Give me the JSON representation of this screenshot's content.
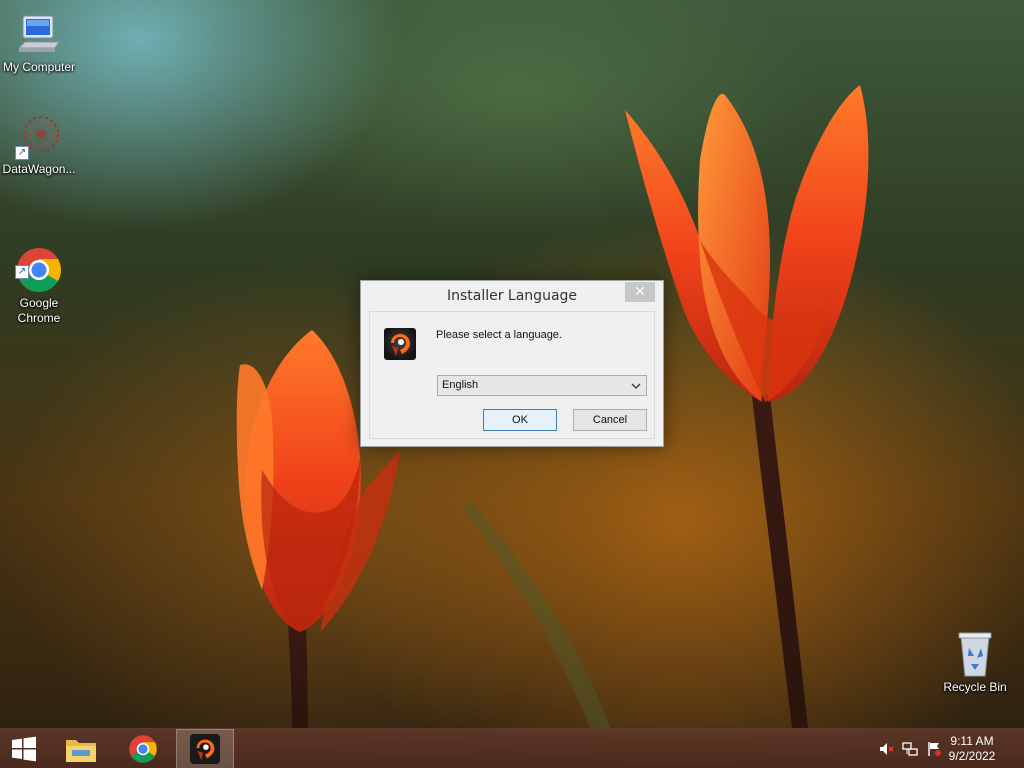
{
  "desktop": {
    "icons": [
      {
        "label": "My Computer",
        "icon": "computer-icon"
      },
      {
        "label": "DataWagon...",
        "icon": "datawagon-icon"
      },
      {
        "label": "Google\nChrome",
        "icon": "chrome-icon"
      },
      {
        "label": "Recycle Bin",
        "icon": "recycle-bin-icon"
      }
    ]
  },
  "dialog": {
    "title": "Installer Language",
    "close_glyph": "✕",
    "prompt": "Please select a language.",
    "language_selected": "English",
    "ok_label": "OK",
    "cancel_label": "Cancel"
  },
  "taskbar": {
    "items": [
      "start-icon",
      "file-explorer-icon",
      "chrome-icon",
      "installer-app-icon"
    ],
    "clock_time": "9:11 AM",
    "clock_date": "9/2/2022"
  },
  "colors": {
    "taskbar": "#5f3728",
    "dialog_bg": "#f0f0f0",
    "ok_border": "#3c7fb1"
  }
}
